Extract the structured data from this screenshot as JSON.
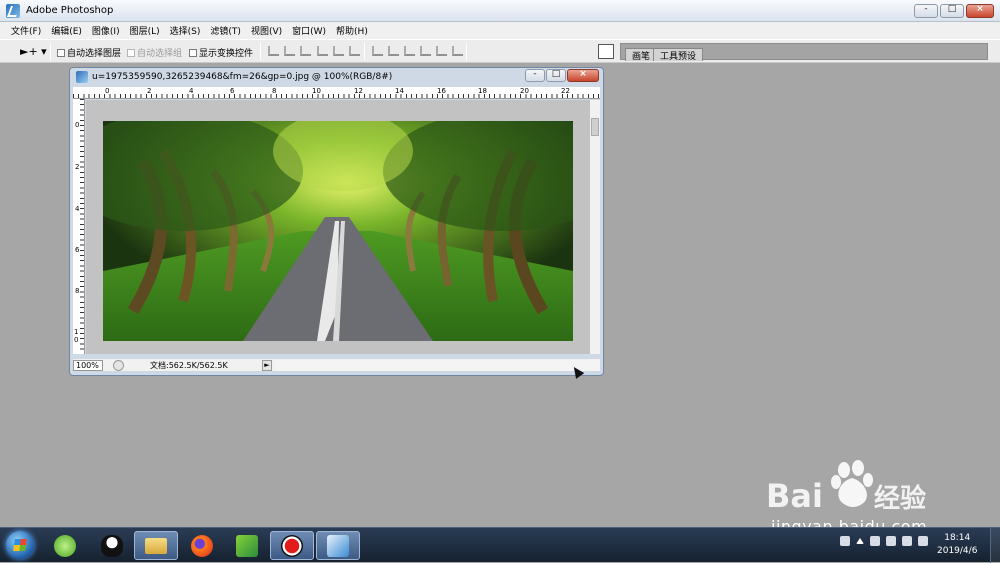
{
  "app": {
    "title": "Adobe Photoshop",
    "icon": "photoshop-feather-icon"
  },
  "window_controls": {
    "minimize": "-",
    "maximize": "□",
    "close": "×"
  },
  "menu": [
    "文件(F)",
    "编辑(E)",
    "图像(I)",
    "图层(L)",
    "选择(S)",
    "滤镜(T)",
    "视图(V)",
    "窗口(W)",
    "帮助(H)"
  ],
  "options_bar": {
    "tool_icon": "move-tool-icon",
    "tool_glyph": "►+ ▾",
    "auto_select_layer": "自动选择图层",
    "auto_select_group": "自动选择组",
    "show_transform_controls": "显示变换控件",
    "auto_select_group_disabled": true,
    "palette_tabs": [
      "画笔",
      "工具预设"
    ]
  },
  "document": {
    "title": "u=1975359590,3265239468&fm=26&gp=0.jpg @ 100%(RGB/8#)",
    "ruler_h_labels": [
      "0",
      "2",
      "4",
      "6",
      "8",
      "10",
      "12",
      "14",
      "16",
      "18",
      "20",
      "22"
    ],
    "ruler_v_labels": [
      "0",
      "2",
      "4",
      "6",
      "8",
      "10"
    ],
    "image_desc_icon": "tree-lined-road-photo",
    "zoom": "100%",
    "doc_info": "文档:562.5K/562.5K",
    "status_arrow": "►"
  },
  "taskbar": {
    "items": [
      "windows-start-icon",
      "360-browser-icon",
      "qq-penguin-icon",
      "file-explorer-icon",
      "firefox-icon",
      "camtasia-icon",
      "record-icon",
      "photoshop-icon"
    ],
    "clock_time": "18:14",
    "clock_date": "2019/4/6"
  },
  "watermark": {
    "brand": "Bai",
    "brand2": "du",
    "suffix": "经验",
    "url": "jingyan.baidu.com"
  },
  "colors": {
    "workspace": "#a6a6a6",
    "taskbar": "#1d2b3d",
    "active_window": "#cfd9e6"
  }
}
